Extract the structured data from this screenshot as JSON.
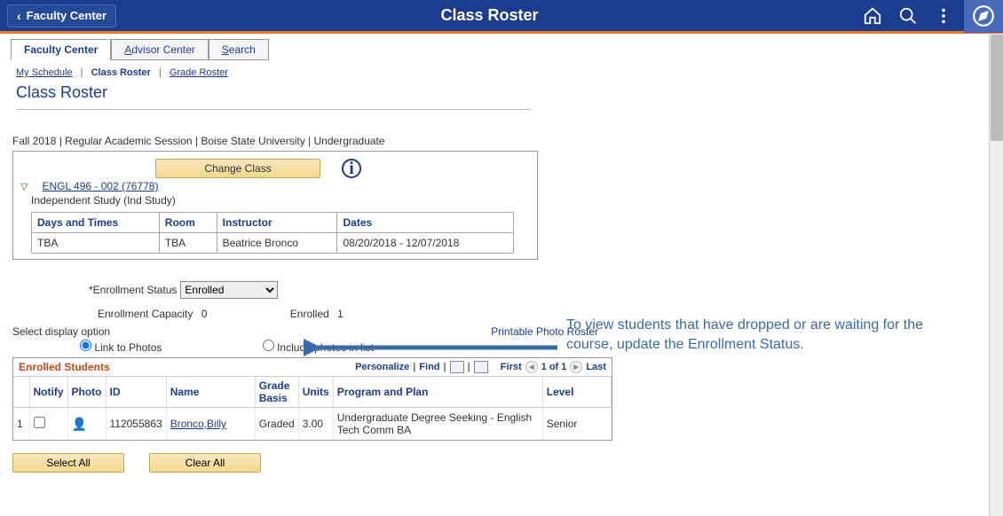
{
  "banner": {
    "back_label": "Faculty Center",
    "title": "Class Roster"
  },
  "tabs": {
    "faculty_center": "Faculty Center",
    "advisor_center": "Advisor Center",
    "search": "Search"
  },
  "breadcrumb": {
    "my_schedule": "My Schedule",
    "class_roster": "Class Roster",
    "grade_roster": "Grade Roster"
  },
  "page_heading": "Class Roster",
  "term_line": "Fall 2018 | Regular Academic Session | Boise State University | Undergraduate",
  "change_class_label": "Change Class",
  "class_link": "ENGL 496 - 002 (76778)",
  "class_desc": "Independent Study (Ind Study)",
  "schedule": {
    "headers": {
      "days": "Days and Times",
      "room": "Room",
      "instructor": "Instructor",
      "dates": "Dates"
    },
    "row": {
      "days": "TBA",
      "room": "TBA",
      "instructor": "Beatrice Bronco",
      "dates": "08/20/2018 - 12/07/2018"
    }
  },
  "enrollment": {
    "status_label": "*Enrollment Status",
    "status_value": "Enrolled",
    "capacity_label": "Enrollment Capacity",
    "capacity_value": "0",
    "enrolled_label": "Enrolled",
    "enrolled_value": "1"
  },
  "display_option": {
    "header": "Select display option",
    "link_photos": "Link to Photos",
    "include_photos": "Include photos in list"
  },
  "printable_label": "Printable Photo Roster",
  "roster": {
    "title": "Enrolled Students",
    "personalize": "Personalize",
    "find": "Find",
    "first": "First",
    "pager": "1 of 1",
    "last": "Last",
    "headers": {
      "notify": "Notify",
      "photo": "Photo",
      "id": "ID",
      "name": "Name",
      "grade_basis": "Grade Basis",
      "units": "Units",
      "program": "Program and Plan",
      "level": "Level"
    },
    "row": {
      "num": "1",
      "id": "112055863",
      "name": "Bronco,Billy",
      "grade_basis": "Graded",
      "units": "3.00",
      "program": "Undergraduate Degree Seeking - English Tech Comm BA",
      "level": "Senior"
    }
  },
  "buttons": {
    "select_all": "Select All",
    "clear_all": "Clear All"
  },
  "annotation": "To view students that have dropped or are waiting for the course, update the Enrollment Status."
}
